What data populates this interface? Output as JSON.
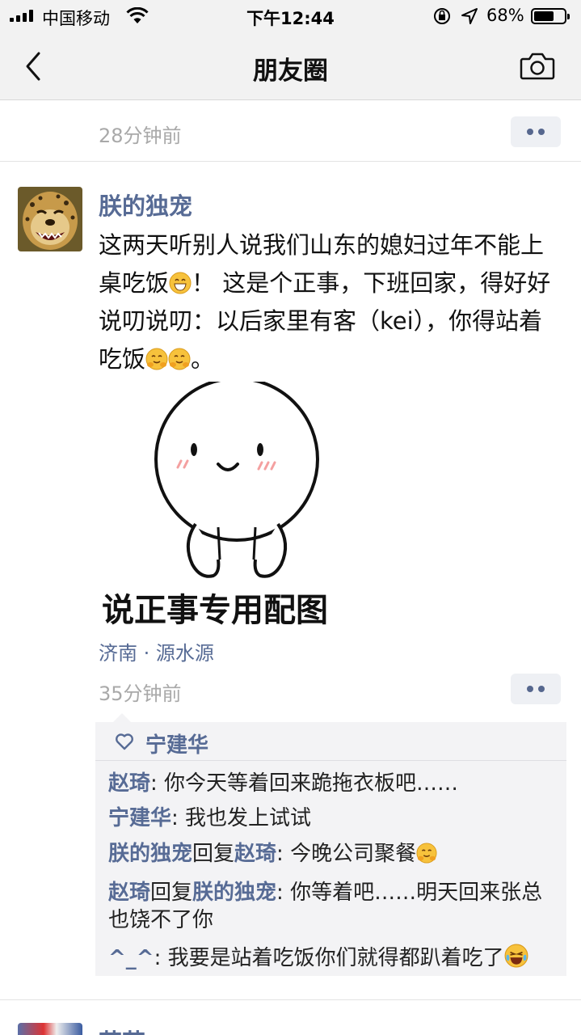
{
  "status_bar": {
    "carrier": "中国移动",
    "time": "下午12:44",
    "battery_percent": "68%",
    "battery_level": 0.68
  },
  "nav": {
    "title": "朋友圈",
    "back_icon": "chevron-left-icon",
    "camera_icon": "camera-icon"
  },
  "prev_post": {
    "time": "28分钟前"
  },
  "post": {
    "author": "朕的独宠",
    "text_parts": [
      "这两天听别人说我们山东的媳妇过年不能上桌吃饭",
      "！ 这是个正事，下班回家，得好好说叨说叨：以后家里有客（kei），你得站着吃饭",
      "。"
    ],
    "image_caption": "说正事专用配图",
    "location": "济南 · 源水源",
    "time": "35分钟前"
  },
  "likes": {
    "names": "宁建华"
  },
  "comments": [
    {
      "from": "赵琦",
      "text": ": 你今天等着回来跪拖衣板吧……"
    },
    {
      "from": "宁建华",
      "text": ": 我也发上试试"
    },
    {
      "from": "朕的独宠",
      "reply_word": "回复",
      "to": "赵琦",
      "text": ": 今晚公司聚餐"
    },
    {
      "from": "赵琦",
      "reply_word": "回复",
      "to": "朕的独宠",
      "text": ": 你等着吧……明天回来张总也饶不了你"
    },
    {
      "from": "^_^",
      "text": ": 我要是站着吃饭你们就得都趴着吃了"
    }
  ],
  "next_post": {
    "author": "花花"
  },
  "colors": {
    "link_blue": "#576b95",
    "meta_gray": "#a9a9a9",
    "comment_bg": "#f3f3f5"
  }
}
